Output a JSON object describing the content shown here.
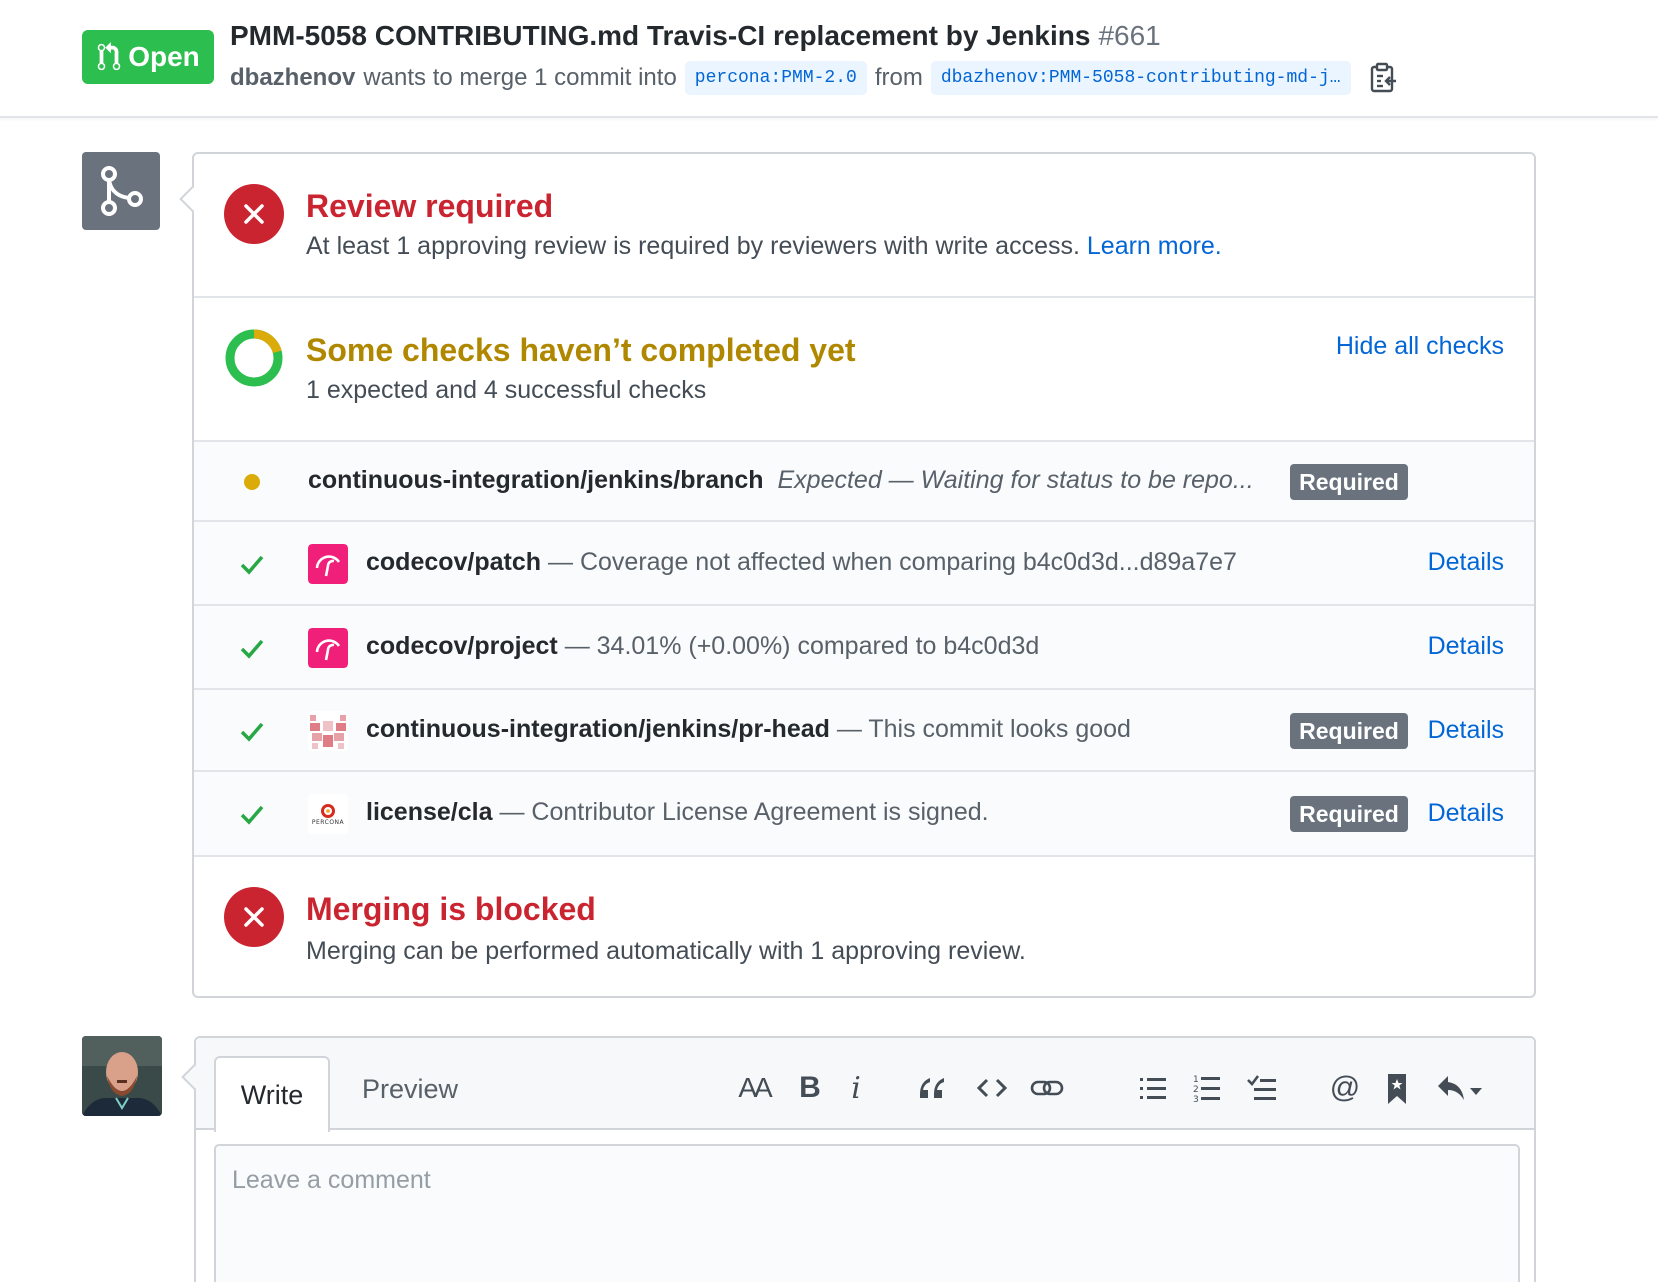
{
  "header": {
    "state": "Open",
    "title": "PMM-5058 CONTRIBUTING.md Travis-CI replacement by Jenkins",
    "number": "#661",
    "author": "dbazhenov",
    "meta_text": "wants to merge 1 commit into",
    "base_branch": "percona:PMM-2.0",
    "from_text": "from",
    "head_branch": "dbazhenov:PMM-5058-contributing-md-j…"
  },
  "merge": {
    "review": {
      "title": "Review required",
      "description": "At least 1 approving review is required by reviewers with write access.",
      "learn_more": "Learn more."
    },
    "checks": {
      "title": "Some checks haven’t completed yet",
      "summary": "1 expected and 4 successful checks",
      "hide_label": "Hide all checks",
      "items": [
        {
          "status": "pending",
          "context": "continuous-integration/jenkins/branch",
          "description": "Expected — Waiting for status to be repo...",
          "required": "Required",
          "details": ""
        },
        {
          "status": "success",
          "context": "codecov/patch",
          "description": "— Coverage not affected when comparing b4c0d3d...d89a7e7",
          "required": "",
          "details": "Details"
        },
        {
          "status": "success",
          "context": "codecov/project",
          "description": "— 34.01% (+0.00%) compared to b4c0d3d",
          "required": "",
          "details": "Details"
        },
        {
          "status": "success",
          "context": "continuous-integration/jenkins/pr-head",
          "description": "— This commit looks good",
          "required": "Required",
          "details": "Details"
        },
        {
          "status": "success",
          "context": "license/cla",
          "description": "— Contributor License Agreement is signed.",
          "required": "Required",
          "details": "Details"
        }
      ]
    },
    "blocked": {
      "title": "Merging is blocked",
      "description": "Merging can be performed automatically with 1 approving review."
    }
  },
  "comment": {
    "tab_write": "Write",
    "tab_preview": "Preview",
    "placeholder": "Leave a comment",
    "percona_logo_text": "PERCONA"
  },
  "colors": {
    "open_green": "#2cbe4e",
    "error_red": "#cb2431",
    "pending_amber": "#dbab09",
    "success_green": "#28a745",
    "link_blue": "#0366d6",
    "codecov_pink": "#f01f7a"
  }
}
